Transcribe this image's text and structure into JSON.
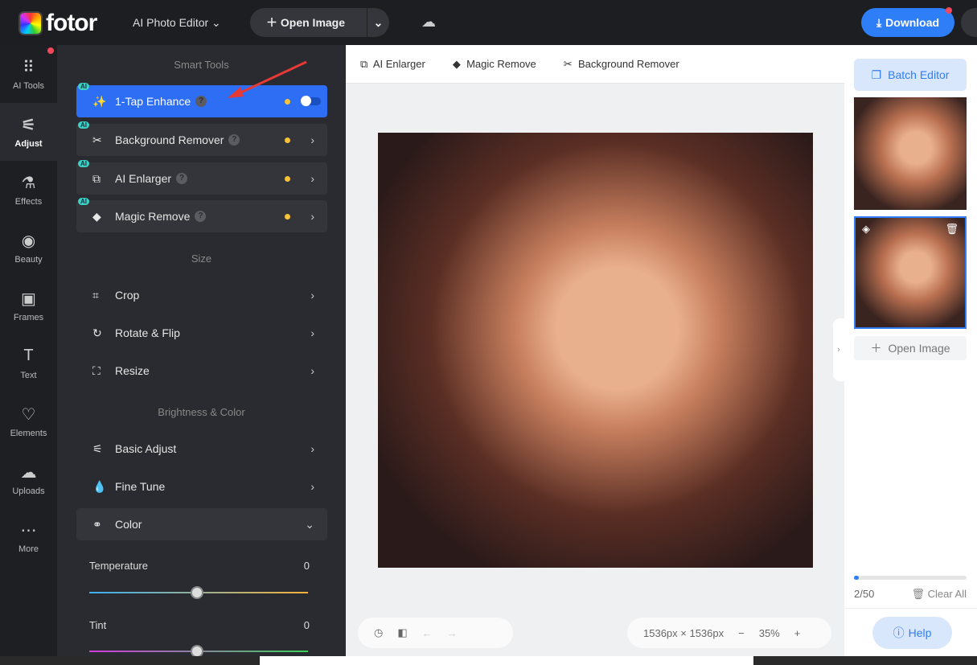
{
  "header": {
    "logo": "fotor",
    "editor_menu": "AI Photo Editor",
    "open_image": "Open Image",
    "download": "Download"
  },
  "rail": [
    {
      "label": "AI Tools",
      "icon": "⠿"
    },
    {
      "label": "Adjust",
      "icon": "⚟"
    },
    {
      "label": "Effects",
      "icon": "⚗"
    },
    {
      "label": "Beauty",
      "icon": "◉"
    },
    {
      "label": "Frames",
      "icon": "▣"
    },
    {
      "label": "Text",
      "icon": "T"
    },
    {
      "label": "Elements",
      "icon": "♡"
    },
    {
      "label": "Uploads",
      "icon": "☁"
    },
    {
      "label": "More",
      "icon": "⋯"
    }
  ],
  "panel": {
    "smart_tools": "Smart Tools",
    "size": "Size",
    "brightness": "Brightness & Color",
    "ai_badge": "AI",
    "smart": [
      {
        "label": "1-Tap Enhance",
        "icon": "✨"
      },
      {
        "label": "Background Remover",
        "icon": "✂"
      },
      {
        "label": "AI Enlarger",
        "icon": "⧉"
      },
      {
        "label": "Magic Remove",
        "icon": "◆"
      }
    ],
    "size_items": [
      {
        "label": "Crop",
        "icon": "⌗"
      },
      {
        "label": "Rotate & Flip",
        "icon": "↻"
      },
      {
        "label": "Resize",
        "icon": "⛶"
      }
    ],
    "color_items": [
      {
        "label": "Basic Adjust",
        "icon": "⚟"
      },
      {
        "label": "Fine Tune",
        "icon": "💧"
      },
      {
        "label": "Color",
        "icon": "⚭"
      }
    ],
    "temperature": {
      "label": "Temperature",
      "value": "0"
    },
    "tint": {
      "label": "Tint",
      "value": "0"
    }
  },
  "toolbar": {
    "ai_enlarger": "AI Enlarger",
    "magic_remove": "Magic Remove",
    "background_remover": "Background Remover"
  },
  "canvas": {
    "dimensions": "1536px × 1536px",
    "zoom": "35%"
  },
  "right": {
    "batch_editor": "Batch Editor",
    "open_image": "Open Image",
    "count": "2/50",
    "clear_all": "Clear All",
    "help": "Help",
    "progress": 0.04
  }
}
